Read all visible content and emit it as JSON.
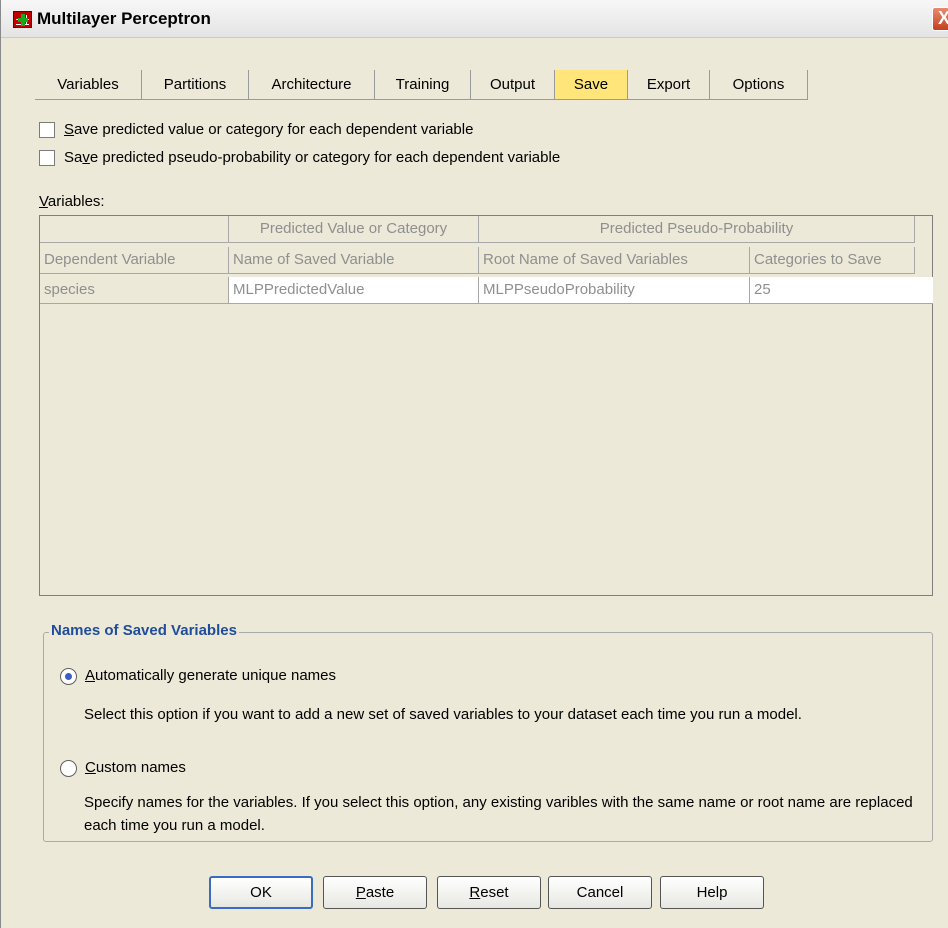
{
  "window": {
    "title": "Multilayer Perceptron",
    "close_glyph": "X",
    "icon": "spss-dialog-icon"
  },
  "tabs": [
    {
      "label": "Variables",
      "active": false
    },
    {
      "label": "Partitions",
      "active": false
    },
    {
      "label": "Architecture",
      "active": false
    },
    {
      "label": "Training",
      "active": false
    },
    {
      "label": "Output",
      "active": false
    },
    {
      "label": "Save",
      "active": true
    },
    {
      "label": "Export",
      "active": false
    },
    {
      "label": "Options",
      "active": false
    }
  ],
  "save_options": {
    "predicted_value": {
      "pre": "",
      "key": "S",
      "post": "ave predicted value or category for each dependent variable",
      "checked": false
    },
    "pseudo_probability": {
      "pre": "Sa",
      "key": "v",
      "post": "e predicted pseudo-probability or category for each dependent variable",
      "checked": false
    }
  },
  "variables": {
    "label_key": "V",
    "label_rest": "ariables:",
    "group_headers": {
      "predicted_value": "Predicted Value or Category",
      "pseudo_probability": "Predicted Pseudo-Probability"
    },
    "columns": {
      "dependent": "Dependent Variable",
      "saved_name": "Name of Saved Variable",
      "root_name": "Root Name of Saved Variables",
      "categories": "Categories to Save"
    },
    "rows": [
      {
        "dependent": "species",
        "saved_name": "MLPPredictedValue",
        "root_name": "MLPPseudoProbability",
        "categories": "25"
      }
    ]
  },
  "names_group": {
    "title": "Names of Saved Variables",
    "auto": {
      "key": "A",
      "rest": "utomatically generate unique names",
      "selected": true,
      "description": "Select this option if you want to add a new set of saved variables to your dataset each time you run a model."
    },
    "custom": {
      "key": "C",
      "rest": "ustom names",
      "selected": false,
      "description": "Specify names for the variables. If you select this option, any existing varibles with the same name or root name are replaced each time you run a model."
    }
  },
  "buttons": {
    "ok": {
      "pre": "OK",
      "key": "",
      "rest": ""
    },
    "paste": {
      "pre": "",
      "key": "P",
      "rest": "aste"
    },
    "reset": {
      "pre": "",
      "key": "R",
      "rest": "eset"
    },
    "cancel": {
      "pre": "Cancel",
      "key": "",
      "rest": ""
    },
    "help": {
      "pre": "Help",
      "key": "",
      "rest": ""
    }
  },
  "colors": {
    "active_tab": "#ffe57a",
    "group_title": "#1f4d9a",
    "dialog_bg": "#ece9d8",
    "close_button": "#c2401e",
    "radio_dot": "#3a5fbf",
    "default_button_border": "#3b6cc4"
  }
}
